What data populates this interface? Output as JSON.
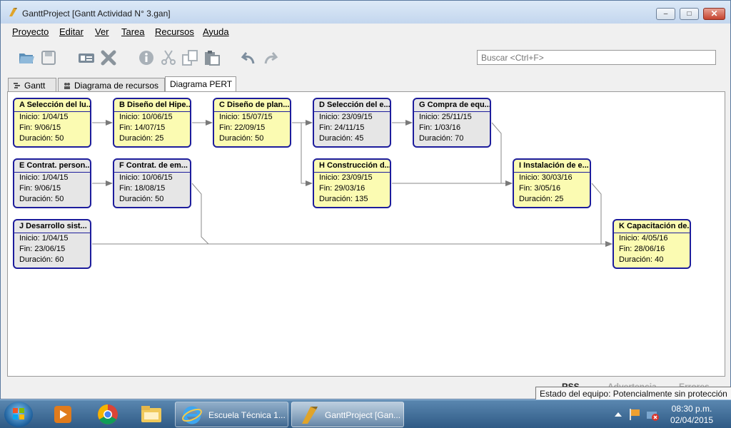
{
  "window": {
    "title": "GanttProject [Gantt Actividad N° 3.gan]",
    "min_label": "–",
    "max_label": "□",
    "close_label": "✕"
  },
  "menu": [
    "Proyecto",
    "Editar",
    "Ver",
    "Tarea",
    "Recursos",
    "Ayuda"
  ],
  "toolbar": {
    "icons": [
      "open-icon",
      "save-icon",
      "properties-icon",
      "delete-icon",
      "info-icon",
      "cut-icon",
      "copy-icon",
      "paste-icon",
      "undo-icon",
      "redo-icon"
    ],
    "search_placeholder": "Buscar <Ctrl+F>"
  },
  "tabs": [
    {
      "label": "Gantt",
      "icon": "gantt-icon"
    },
    {
      "label": "Diagrama de recursos",
      "icon": "resources-icon"
    },
    {
      "label": "Diagrama PERT",
      "icon": ""
    }
  ],
  "active_tab": "Diagrama PERT",
  "pert": {
    "nodes": [
      {
        "title": "A Selección del lu...",
        "inicio": "Inicio: 1/04/15",
        "fin": "Fin: 9/06/15",
        "duracion": "Duración: 50",
        "color": "yellow"
      },
      {
        "title": "B Diseño del Hipe...",
        "inicio": "Inicio: 10/06/15",
        "fin": "Fin: 14/07/15",
        "duracion": "Duración: 25",
        "color": "yellow"
      },
      {
        "title": "C Diseño de plan...",
        "inicio": "Inicio: 15/07/15",
        "fin": "Fin: 22/09/15",
        "duracion": "Duración: 50",
        "color": "yellow"
      },
      {
        "title": "D Selección del e...",
        "inicio": "Inicio: 23/09/15",
        "fin": "Fin: 24/11/15",
        "duracion": "Duración: 45",
        "color": "grey"
      },
      {
        "title": "G Compra de equ...",
        "inicio": "Inicio: 25/11/15",
        "fin": "Fin: 1/03/16",
        "duracion": "Duración: 70",
        "color": "grey"
      },
      {
        "title": "E Contrat. person...",
        "inicio": "Inicio: 1/04/15",
        "fin": "Fin: 9/06/15",
        "duracion": "Duración: 50",
        "color": "grey"
      },
      {
        "title": "F Contrat. de em...",
        "inicio": "Inicio: 10/06/15",
        "fin": "Fin: 18/08/15",
        "duracion": "Duración: 50",
        "color": "grey"
      },
      {
        "title": "H Construcción d...",
        "inicio": "Inicio: 23/09/15",
        "fin": "Fin: 29/03/16",
        "duracion": "Duración: 135",
        "color": "yellow"
      },
      {
        "title": "I Instalación de e...",
        "inicio": "Inicio: 30/03/16",
        "fin": "Fin: 3/05/16",
        "duracion": "Duración: 25",
        "color": "yellow"
      },
      {
        "title": "J Desarrollo sist...",
        "inicio": "Inicio: 1/04/15",
        "fin": "Fin: 23/06/15",
        "duracion": "Duración: 60",
        "color": "grey"
      },
      {
        "title": "K Capacitación de...",
        "inicio": "Inicio: 4/05/16",
        "fin": "Fin: 28/06/16",
        "duracion": "Duración: 40",
        "color": "yellow"
      }
    ]
  },
  "status": {
    "rss": "RSS",
    "advertencia": "Advertencia",
    "errores": "Errores",
    "tooltip": "Estado del equipo: Potencialmente sin protección"
  },
  "taskbar": {
    "buttons": [
      {
        "label": "Escuela Técnica 1...",
        "icon": "internet-explorer-icon"
      },
      {
        "label": "GanttProject [Gan...",
        "icon": "ganttproject-icon"
      }
    ],
    "pinned": [
      "media-player-icon",
      "chrome-icon",
      "file-explorer-icon"
    ],
    "clock_time": "08:30 p.m.",
    "clock_date": "02/04/2015"
  }
}
